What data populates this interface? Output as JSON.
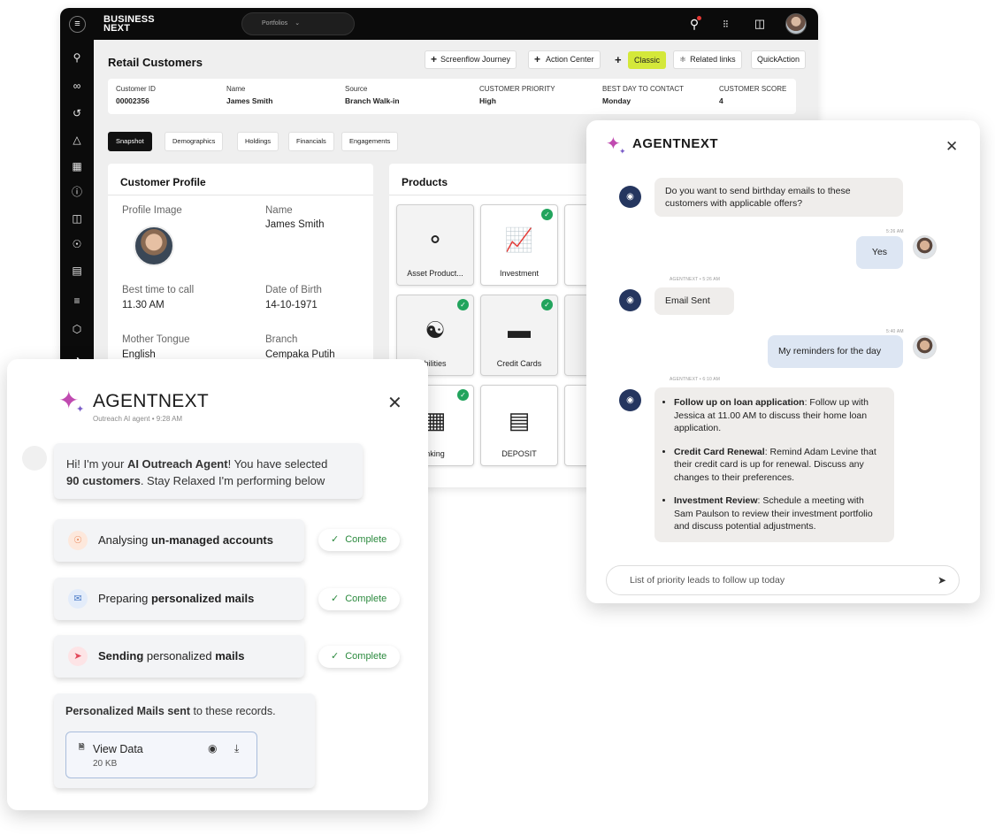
{
  "crm": {
    "brand_line1": "BUSINESS",
    "brand_line2": "NEXT",
    "portfolio_label": "Portfolios",
    "page_title": "Retail Customers",
    "actions": {
      "screenflow": "Screenflow Journey",
      "action_center": "Action Center",
      "classic": "Classic",
      "related_links": "Related links",
      "quick_action": "QuickAction"
    },
    "info": [
      {
        "label": "Customer ID",
        "value": "00002356"
      },
      {
        "label": "Name",
        "value": "James Smith"
      },
      {
        "label": "Source",
        "value": "Branch Walk-in"
      },
      {
        "label": "CUSTOMER PRIORITY",
        "value": "High"
      },
      {
        "label": "BEST DAY TO CONTACT",
        "value": "Monday"
      },
      {
        "label": "CUSTOMER SCORE",
        "value": "4"
      }
    ],
    "tabs": [
      "Snapshot",
      "Demographics",
      "Holdings",
      "Financials",
      "Engagements"
    ],
    "active_tab": "Snapshot",
    "profile": {
      "title": "Customer Profile",
      "image_label": "Profile Image",
      "name_label": "Name",
      "name_value": "James Smith",
      "best_time_label": "Best time to call",
      "best_time_value": "11.30 AM",
      "dob_label": "Date of Birth",
      "dob_value": "14-10-1971",
      "tongue_label": "Mother Tongue",
      "tongue_value": "English",
      "branch_label": "Branch",
      "branch_value": "Cempaka Putih"
    },
    "products": {
      "title": "Products",
      "tiles": [
        {
          "label": "Asset Product...",
          "icon": "hand-coin-icon",
          "checked": false
        },
        {
          "label": "Investment",
          "icon": "investment-chart-icon",
          "checked": true
        },
        {
          "label": "bilities",
          "icon": "coins-stack-icon",
          "checked": true
        },
        {
          "label": "Credit Cards",
          "icon": "credit-card-icon",
          "checked": true
        },
        {
          "label": "nking",
          "icon": "phone-banking-icon",
          "checked": true
        },
        {
          "label": "DEPOSIT",
          "icon": "deposit-icon",
          "checked": false
        }
      ]
    }
  },
  "chat": {
    "brand": "AGENTNEXT",
    "messages": {
      "q1": "Do you want to send birthday emails to these customers with applicable offers?",
      "yes": "Yes",
      "yes_time": "5:26 AM",
      "email_meta": "AGENTNEXT • 5:26 AM",
      "email_sent": "Email Sent",
      "reminders_time": "5:40 AM",
      "reminders": "My reminders for the day",
      "tasks_meta": "AGENTNEXT • 6:10 AM",
      "tasks": [
        {
          "title": "Follow up on loan application",
          "text": ": Follow up with Jessica at 11.00 AM to discuss their home loan application."
        },
        {
          "title": "Credit Card Renewal",
          "text": ": Remind Adam Levine that their credit card is up for renewal. Discuss any changes to their preferences."
        },
        {
          "title": "Investment Review",
          "text": ": Schedule a meeting with Sam Paulson to review their investment portfolio and discuss potential adjustments."
        }
      ]
    },
    "input_placeholder": "List of priority leads to follow up today"
  },
  "outreach": {
    "brand": "AGENTNEXT",
    "meta": "Outreach AI agent  •  9:28 AM",
    "intro": {
      "p1": "Hi! I'm your ",
      "b1": "AI Outreach Agent",
      "p2": "!  You have selected",
      "b2": "90 customers",
      "p3": ". Stay Relaxed I'm performing below"
    },
    "steps": [
      {
        "pre": "Analysing ",
        "bold": "un-managed accounts",
        "post": "",
        "icon": "user-icon",
        "status": "Complete"
      },
      {
        "pre": "Preparing ",
        "bold": "personalized mails",
        "post": "",
        "icon": "mail-icon",
        "status": "Complete"
      },
      {
        "pre": "",
        "bold": "Sending",
        "post": " personalized ",
        "bold2": "mails",
        "icon": "send-icon",
        "status": "Complete"
      }
    ],
    "sent_bold": "Personalized Mails sent",
    "sent_rest": " to these records.",
    "file": {
      "name": "View Data",
      "size": "20 KB",
      "type": "PDF"
    }
  },
  "colors": {
    "accent_lime": "#d4e83a",
    "check_green": "#22a45d",
    "complete_green": "#2b8a3e",
    "bot_avatar": "#25365f",
    "spark_pink": "#c04ab0"
  }
}
